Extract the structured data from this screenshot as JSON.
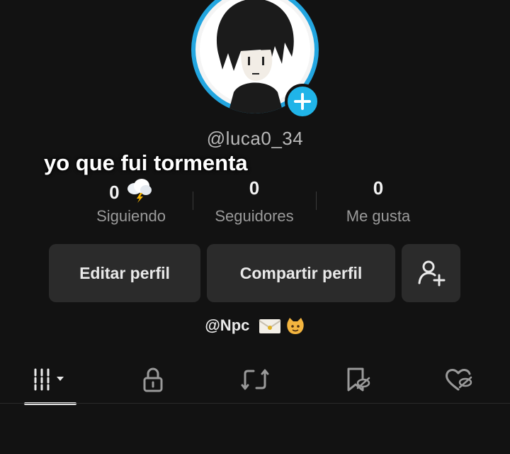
{
  "profile": {
    "username": "@luca0_34",
    "overlay_caption": "yo que fui tormenta"
  },
  "stats": [
    {
      "value": "0",
      "label": "Siguiendo"
    },
    {
      "value": "0",
      "label": "Seguidores"
    },
    {
      "value": "0",
      "label": "Me gusta"
    }
  ],
  "actions": {
    "edit_label": "Editar perfil",
    "share_label": "Compartir perfil",
    "add_friend_icon": "add-user-icon"
  },
  "bio": {
    "text": "@Npc"
  },
  "tabs": [
    {
      "icon": "grid-icon",
      "active": true
    },
    {
      "icon": "lock-icon"
    },
    {
      "icon": "repost-icon"
    },
    {
      "icon": "bookmark-hidden-icon"
    },
    {
      "icon": "heart-hidden-icon"
    }
  ],
  "colors": {
    "background": "#121212",
    "avatar_ring": "#23a6e0",
    "button_bg": "#2b2b2b",
    "muted_text": "#9a9a9a"
  }
}
